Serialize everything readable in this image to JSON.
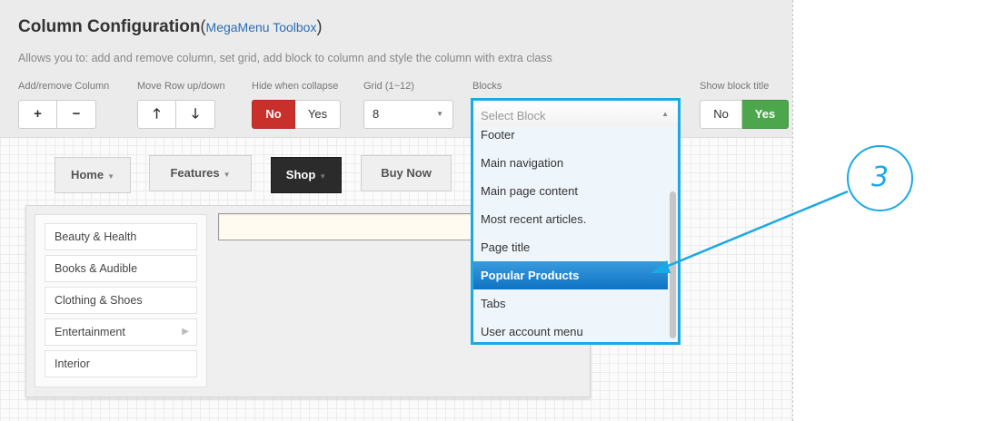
{
  "header": {
    "title": "Column Configuration",
    "title_paren_open": "(",
    "title_link": "MegaMenu Toolbox",
    "title_paren_close": ")",
    "description": "Allows you to: add and remove column, set grid, add block to column and style the column with extra class"
  },
  "controls": {
    "add_remove_label": "Add/remove Column",
    "move_row_label": "Move Row up/down",
    "hide_collapse_label": "Hide when collapse",
    "hide_no": "No",
    "hide_yes": "Yes",
    "grid_label": "Grid (1~12)",
    "grid_value": "8",
    "blocks_label": "Blocks",
    "show_title_label": "Show block title",
    "show_no": "No",
    "show_yes": "Yes"
  },
  "nav": {
    "items": [
      "Home",
      "Features",
      "Shop",
      "Buy Now"
    ]
  },
  "categories": [
    "Beauty & Health",
    "Books & Audible",
    "Clothing & Shoes",
    "Entertainment",
    "Interior"
  ],
  "blocks_dropdown": {
    "placeholder": "Select Block",
    "items": [
      "Footer",
      "Main navigation",
      "Main page content",
      "Most recent articles.",
      "Page title",
      "Popular Products",
      "Tabs",
      "User account menu"
    ],
    "highlighted": "Popular Products"
  },
  "callout": {
    "number": "3"
  },
  "colors": {
    "accent": "#1aa9e4",
    "no_active": "#c9302c",
    "yes_active": "#4ca64c",
    "link": "#2a6db6",
    "highlight": "#0e73c4"
  },
  "icons": {
    "plus": "plus-icon",
    "minus": "minus-icon",
    "up": "arrow-up-icon",
    "down": "arrow-down-icon",
    "caret": "caret-down-icon",
    "submenu": "caret-right-icon"
  }
}
